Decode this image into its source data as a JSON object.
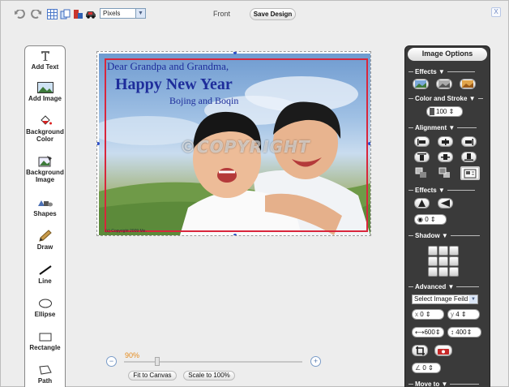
{
  "toolbar": {
    "units_value": "Pixels",
    "side_label": "Front",
    "save_label": "Save Design",
    "close_label": "X"
  },
  "tools": [
    {
      "label": "Add Text",
      "icon": "text-tool-icon"
    },
    {
      "label": "Add Image",
      "icon": "image-icon"
    },
    {
      "label": "Background Color",
      "icon": "paint-bucket-icon"
    },
    {
      "label": "Background Image",
      "icon": "background-image-icon"
    },
    {
      "label": "Shapes",
      "icon": "shapes-icon"
    },
    {
      "label": "Draw",
      "icon": "pencil-icon"
    },
    {
      "label": "Line",
      "icon": "line-icon"
    },
    {
      "label": "Ellipse",
      "icon": "ellipse-icon"
    },
    {
      "label": "Rectangle",
      "icon": "rectangle-icon"
    },
    {
      "label": "Path",
      "icon": "path-icon"
    }
  ],
  "canvas": {
    "line1": "Dear Grandpa and Grandma,",
    "line2": "Happy New Year",
    "line3": "Bojing and Boqin",
    "watermark": "©COPYRIGHT",
    "footer_small": "(c) Copyright 2009 Me."
  },
  "zoom": {
    "percent": "90%",
    "fit_label": "Fit to Canvas",
    "scale_label": "Scale to 100%"
  },
  "panel": {
    "title": "Image Options",
    "effects_label": "Effects",
    "color_stroke_label": "Color and Stroke",
    "stroke_value": "100",
    "alignment_label": "Alignment",
    "effects2_label": "Effects",
    "rotate_value": "0",
    "shadow_label": "Shadow",
    "advanced_label": "Advanced",
    "select_field": "Select Image Feild",
    "x_label": "x",
    "x_value": "0",
    "y_label": "y",
    "y_value": "4",
    "width_value": "600",
    "height_value": "400",
    "angle_value": "0",
    "move_to_label": "Move to"
  }
}
